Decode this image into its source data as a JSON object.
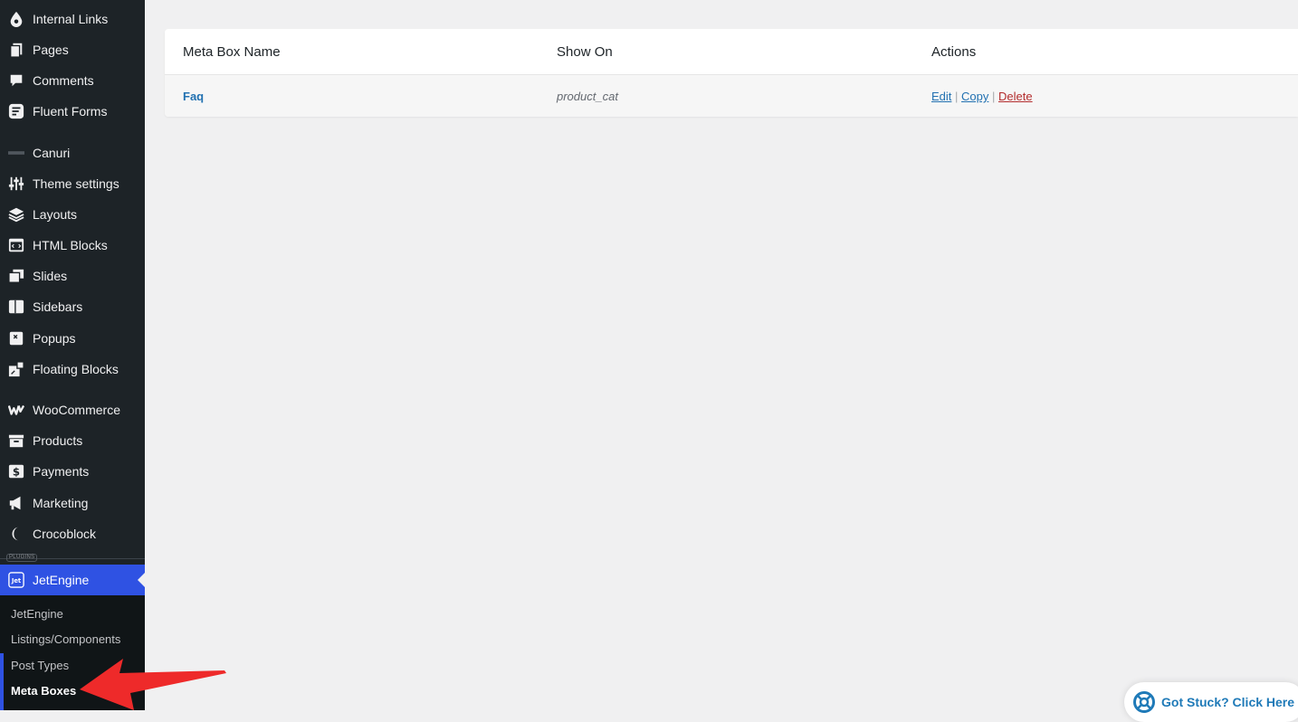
{
  "sidebar": {
    "items": [
      {
        "label": "Internal Links",
        "icon": "droplet-icon"
      },
      {
        "label": "Pages",
        "icon": "pages-icon"
      },
      {
        "label": "Comments",
        "icon": "comment-icon"
      },
      {
        "label": "Fluent Forms",
        "icon": "fluent-forms-icon"
      },
      {
        "label": "Canuri",
        "icon": "canuri-logo-icon"
      },
      {
        "label": "Theme settings",
        "icon": "sliders-icon"
      },
      {
        "label": "Layouts",
        "icon": "layers-icon"
      },
      {
        "label": "HTML Blocks",
        "icon": "code-block-icon"
      },
      {
        "label": "Slides",
        "icon": "slides-icon"
      },
      {
        "label": "Sidebars",
        "icon": "sidebar-icon"
      },
      {
        "label": "Popups",
        "icon": "popup-icon"
      },
      {
        "label": "Floating Blocks",
        "icon": "floating-block-icon"
      },
      {
        "label": "WooCommerce",
        "icon": "woocommerce-icon"
      },
      {
        "label": "Products",
        "icon": "archive-box-icon"
      },
      {
        "label": "Payments",
        "icon": "dollar-icon"
      },
      {
        "label": "Marketing",
        "icon": "megaphone-icon"
      },
      {
        "label": "Crocoblock",
        "icon": "crocoblock-icon"
      }
    ],
    "plugins_label": "PLUGINS",
    "active_item": {
      "label": "JetEngine",
      "icon": "jetengine-icon"
    },
    "submenu": [
      {
        "label": "JetEngine"
      },
      {
        "label": "Listings/Components"
      },
      {
        "label": "Post Types"
      },
      {
        "label": "Meta Boxes",
        "current": true
      }
    ]
  },
  "table": {
    "columns": [
      "Meta Box Name",
      "Show On",
      "Actions"
    ],
    "rows": [
      {
        "name": "Faq",
        "show_on": "product_cat",
        "actions": {
          "edit": "Edit",
          "copy": "Copy",
          "delete": "Delete",
          "separator": "|"
        }
      }
    ]
  },
  "help_widget": {
    "label": "Got Stuck? Click Here",
    "icon": "lifebuoy-icon"
  },
  "colors": {
    "sidebar_bg": "#1d2327",
    "active_bg": "#2f52e3",
    "link": "#2271b1",
    "danger": "#b32d2e",
    "annotation_arrow": "#ee2a2a"
  }
}
